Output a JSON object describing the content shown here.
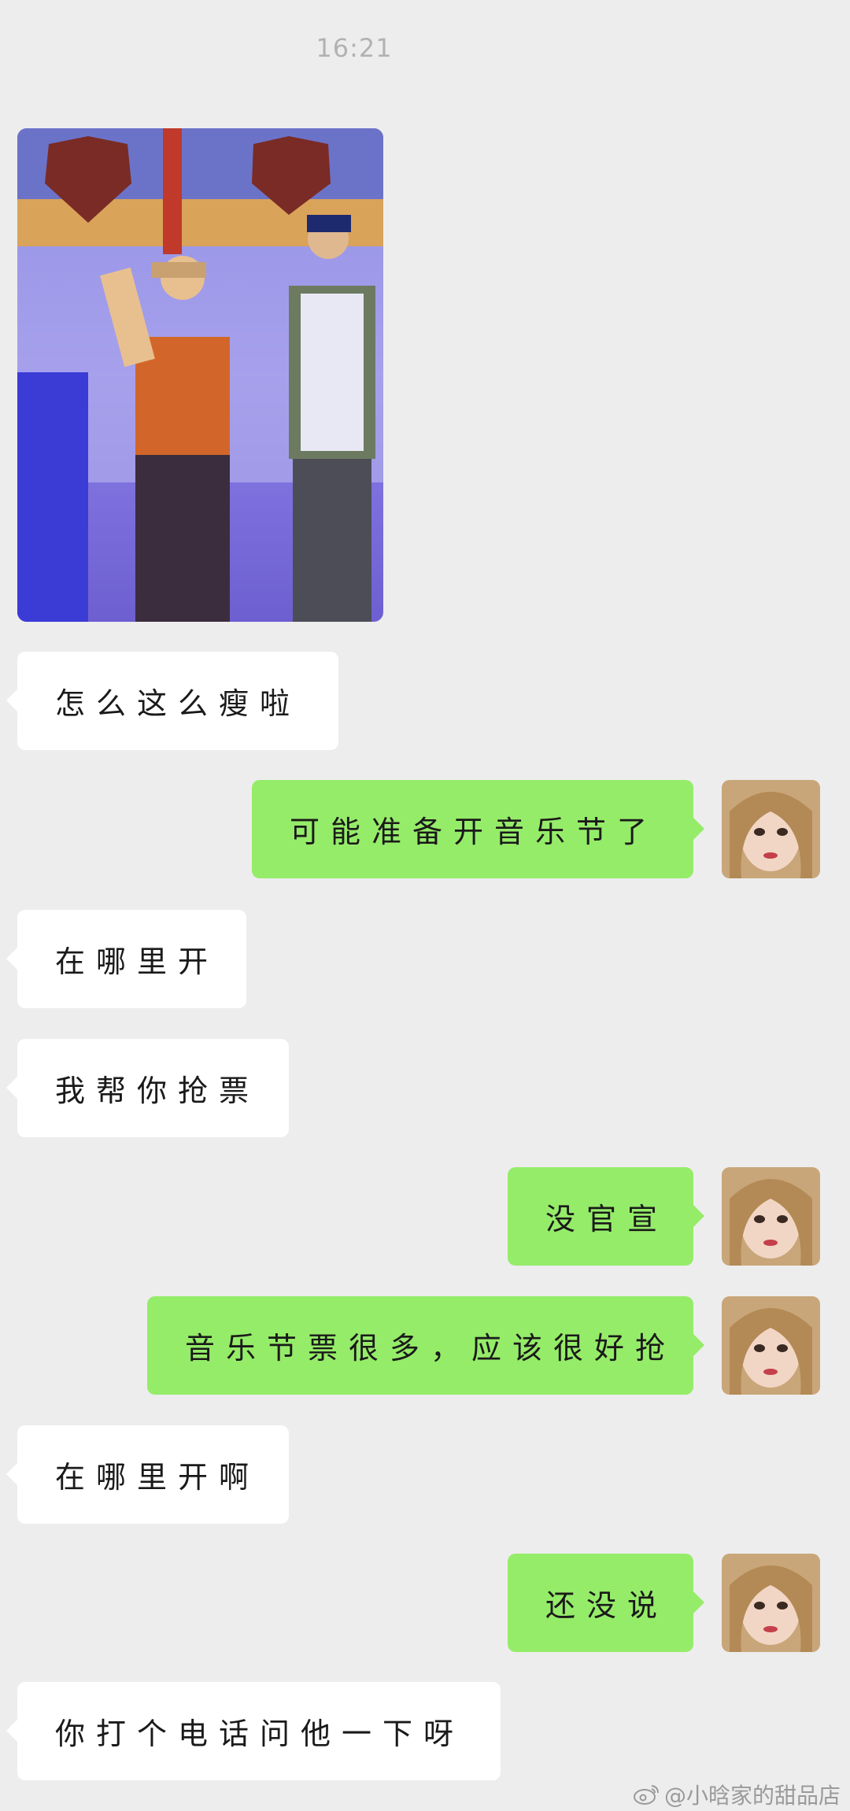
{
  "timestamp": "16:21",
  "photo": {
    "description_icon": "photo-thumbnail"
  },
  "messages": [
    {
      "side": "in",
      "text": "怎么这么瘦啦"
    },
    {
      "side": "out",
      "text": "可能准备开音乐节了"
    },
    {
      "side": "in",
      "text": "在哪里开"
    },
    {
      "side": "in",
      "text": "我帮你抢票"
    },
    {
      "side": "out",
      "text": "没官宣"
    },
    {
      "side": "out",
      "text": "音乐节票很多，应该很好抢"
    },
    {
      "side": "in",
      "text": "在哪里开啊"
    },
    {
      "side": "out",
      "text": "还没说"
    },
    {
      "side": "in",
      "text": "你打个电话问他一下呀"
    }
  ],
  "watermark": "@小晗家的甜品店",
  "colors": {
    "background": "#ededed",
    "incoming_bubble": "#ffffff",
    "outgoing_bubble": "#95ec69"
  }
}
